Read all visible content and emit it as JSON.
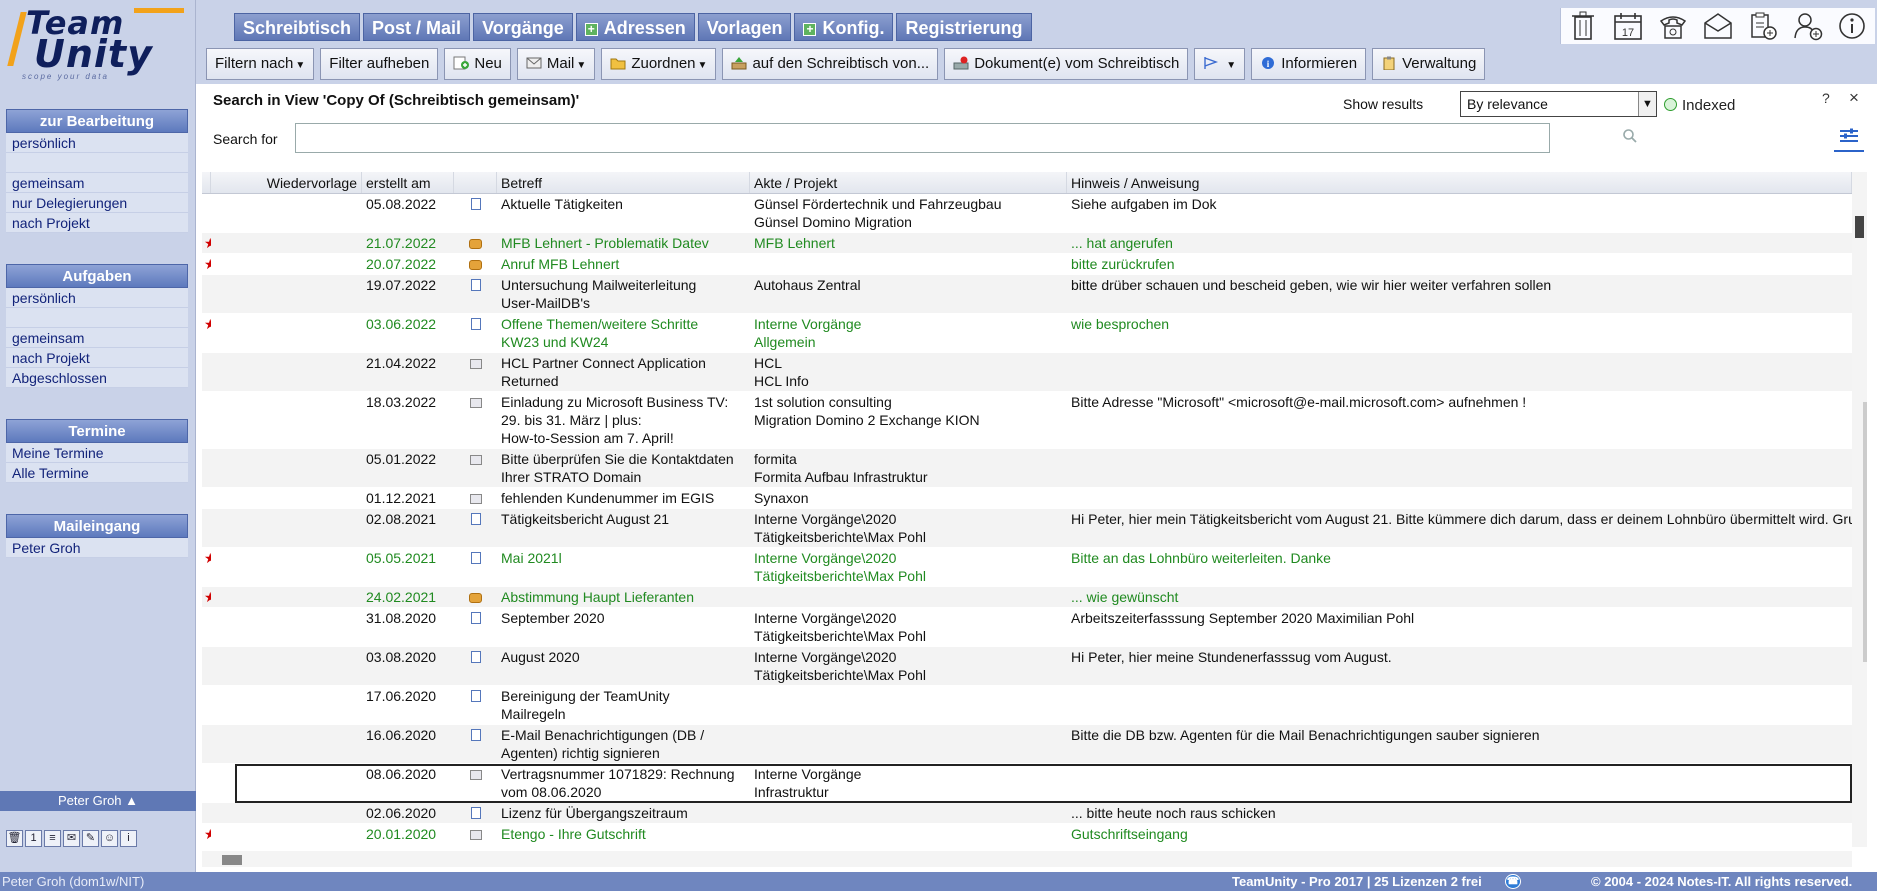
{
  "logo": {
    "line1": "Team",
    "line2": "Unity",
    "slogan": "scope your data"
  },
  "tabs": [
    {
      "label": "Schreibtisch",
      "plus": false
    },
    {
      "label": "Post / Mail",
      "plus": false
    },
    {
      "label": "Vorgänge",
      "plus": false
    },
    {
      "label": "Adressen",
      "plus": true
    },
    {
      "label": "Vorlagen",
      "plus": false
    },
    {
      "label": "Konfig.",
      "plus": true
    },
    {
      "label": "Registrierung",
      "plus": false
    }
  ],
  "top_icons": [
    "trash-icon",
    "calendar-icon",
    "phone-icon",
    "mail-envelope-icon",
    "clipboard-add-icon",
    "user-add-icon",
    "info-icon"
  ],
  "toolbar": {
    "filter": "Filtern nach",
    "filter_clear": "Filter aufheben",
    "new": "Neu",
    "mail": "Mail",
    "assign": "Zuordnen",
    "to_desk": "auf den Schreibtisch von...",
    "from_desk": "Dokument(e) vom Schreibtisch",
    "inform": "Informieren",
    "admin": "Verwaltung"
  },
  "sidebar": {
    "section1": {
      "title": "zur Bearbeitung",
      "items": [
        "persönlich",
        "gemeinsam",
        "nur Delegierungen",
        "nach Projekt"
      ]
    },
    "section2": {
      "title": "Aufgaben",
      "items": [
        "persönlich",
        "gemeinsam",
        "nach Projekt",
        "Abgeschlossen"
      ]
    },
    "section3": {
      "title": "Termine",
      "items": [
        "Meine Termine",
        "Alle Termine"
      ]
    },
    "section4": {
      "title": "Maileingang",
      "items": [
        "Peter Groh"
      ]
    },
    "user_menu": "Peter Groh"
  },
  "search": {
    "title": "Search in View 'Copy Of (Schreibtisch gemeinsam)'",
    "show_results_label": "Show results",
    "sort_value": "By relevance",
    "indexed_label": "Indexed",
    "search_for_label": "Search for",
    "help": "?",
    "close": "×"
  },
  "grid": {
    "columns": [
      "Wiedervorlage",
      "erstellt am",
      "",
      "Betreff",
      "Akte / Projekt",
      "Hinweis / Anweisung"
    ],
    "rows": [
      {
        "star": "",
        "wv": "",
        "date": "05.08.2022",
        "icon": "doc",
        "subject": "Aktuelle Tätigkeiten",
        "akte": "Günsel Fördertechnik und Fahrzeugbau\nGünsel Domino Migration",
        "hint": "Siehe aufgaben im Dok",
        "green": false
      },
      {
        "star": "★",
        "wv": "",
        "date": "21.07.2022",
        "icon": "tel",
        "subject": "MFB Lehnert - Problematik Datev",
        "akte": "MFB Lehnert",
        "hint": "... hat angerufen",
        "green": true
      },
      {
        "star": "★",
        "wv": "",
        "date": "20.07.2022",
        "icon": "tel",
        "subject": "Anruf MFB Lehnert",
        "akte": "",
        "hint": "bitte zurückrufen",
        "green": true
      },
      {
        "star": "",
        "wv": "",
        "date": "19.07.2022",
        "icon": "doc",
        "subject": "Untersuchung Mailweiterleitung\nUser-MailDB's",
        "akte": "Autohaus Zentral",
        "hint": "bitte drüber schauen und bescheid geben, wie wir hier weiter verfahren sollen",
        "green": false
      },
      {
        "star": "★",
        "wv": "",
        "date": "03.06.2022",
        "icon": "doc",
        "subject": "Offene Themen/weitere Schritte\nKW23 und KW24",
        "akte": "Interne Vorgänge\nAllgemein",
        "hint": "wie besprochen",
        "green": true
      },
      {
        "star": "",
        "wv": "",
        "date": "21.04.2022",
        "icon": "mail",
        "subject": "HCL Partner Connect Application\nReturned",
        "akte": "HCL\nHCL Info",
        "hint": "",
        "green": false
      },
      {
        "star": "",
        "wv": "",
        "date": "18.03.2022",
        "icon": "mail",
        "subject": "Einladung zu Microsoft Business TV:\n29. bis 31. März | plus:\nHow-to-Session am 7. April!",
        "akte": "1st solution consulting\nMigration Domino 2 Exchange KION",
        "hint": "Bitte Adresse \"Microsoft\" <microsoft@e-mail.microsoft.com> aufnehmen !",
        "green": false
      },
      {
        "star": "",
        "wv": "",
        "date": "05.01.2022",
        "icon": "mail",
        "subject": "Bitte überprüfen Sie die Kontaktdaten\nIhrer STRATO Domain",
        "akte": "formita\nFormita Aufbau Infrastruktur",
        "hint": "",
        "green": false
      },
      {
        "star": "",
        "wv": "",
        "date": "01.12.2021",
        "icon": "mail",
        "subject": "fehlenden Kundenummer im EGIS",
        "akte": "Synaxon",
        "hint": "",
        "green": false
      },
      {
        "star": "",
        "wv": "",
        "date": "02.08.2021",
        "icon": "doc",
        "subject": "Tätigkeitsbericht August 21",
        "akte": "Interne Vorgänge\\2020\nTätigkeitsberichte\\Max Pohl",
        "hint": "Hi Peter, hier mein Tätigkeitsbericht vom August 21. Bitte kümmere dich darum, dass er deinem Lohnbüro übermittelt\nwird.  Gruß Max",
        "green": false
      },
      {
        "star": "★",
        "wv": "",
        "date": "05.05.2021",
        "icon": "doc",
        "subject": " Mai 2021l",
        "akte": "Interne Vorgänge\\2020\nTätigkeitsberichte\\Max Pohl",
        "hint": "Bitte an das Lohnbüro weiterleiten. Danke",
        "green": true
      },
      {
        "star": "★",
        "wv": "",
        "date": "24.02.2021",
        "icon": "tel",
        "subject": "Abstimmung Haupt Lieferanten",
        "akte": "",
        "hint": "... wie gewünscht",
        "green": true
      },
      {
        "star": "",
        "wv": "",
        "date": "31.08.2020",
        "icon": "doc",
        "subject": "September 2020",
        "akte": "Interne Vorgänge\\2020\nTätigkeitsberichte\\Max Pohl",
        "hint": "Arbeitszeiterfasssung September 2020 Maximilian Pohl",
        "green": false
      },
      {
        "star": "",
        "wv": "",
        "date": "03.08.2020",
        "icon": "doc",
        "subject": "August 2020",
        "akte": "Interne Vorgänge\\2020\nTätigkeitsberichte\\Max Pohl",
        "hint": "Hi Peter, hier meine Stundenerfasssug vom August.",
        "green": false
      },
      {
        "star": "",
        "wv": "",
        "date": "17.06.2020",
        "icon": "doc",
        "subject": "Bereinigung der TeamUnity\nMailregeln",
        "akte": "",
        "hint": "",
        "green": false
      },
      {
        "star": "",
        "wv": "",
        "date": "16.06.2020",
        "icon": "doc",
        "subject": "E-Mail Benachrichtigungen (DB /\nAgenten) richtig signieren",
        "akte": "",
        "hint": "Bitte die DB bzw. Agenten für die Mail  Benachrichtigungen sauber signieren",
        "green": false
      },
      {
        "star": "",
        "wv": "",
        "date": "08.06.2020",
        "icon": "mail",
        "subject": "Vertragsnummer 1071829:  Rechnung\nvom 08.06.2020",
        "akte": "Interne Vorgänge\nInfrastruktur",
        "hint": "",
        "green": false,
        "selected": true
      },
      {
        "star": "",
        "wv": "",
        "date": "02.06.2020",
        "icon": "doc",
        "subject": "Lizenz für Übergangszeitraum",
        "akte": "",
        "hint": "... bitte heute noch raus schicken",
        "green": false
      },
      {
        "star": "★",
        "wv": "",
        "date": "20.01.2020",
        "icon": "mail",
        "subject": "Etengo - Ihre Gutschrift",
        "akte": "",
        "hint": "Gutschriftseingang",
        "green": true
      }
    ]
  },
  "status": {
    "user": "Peter Groh (dom1w/NIT)",
    "license": "TeamUnity - Pro 2017  |  25 Lizenzen 2 frei",
    "copyright": "© 2004 - 2024  Notes-IT. All rights reserved."
  }
}
